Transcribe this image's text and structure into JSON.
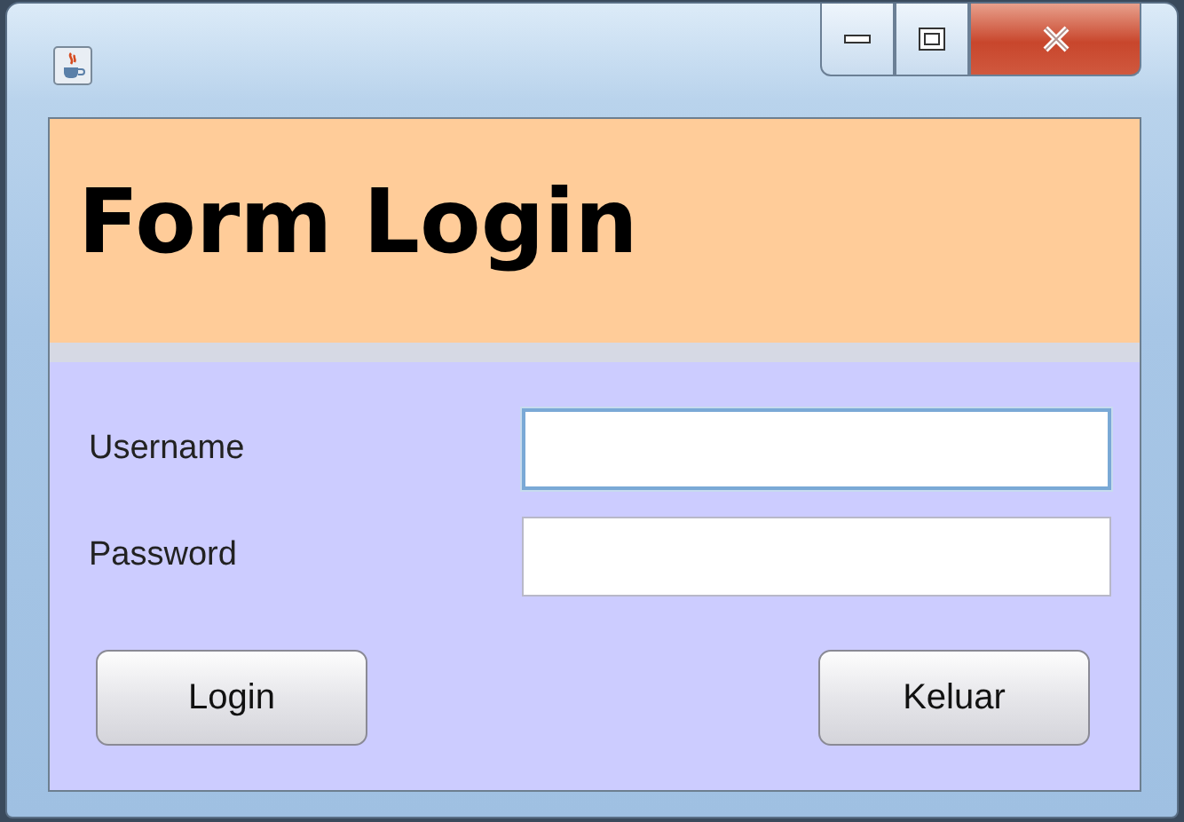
{
  "header": {
    "title": "Form Login"
  },
  "fields": [
    {
      "label": "Username",
      "focused": true
    },
    {
      "label": "Password",
      "focused": false
    }
  ],
  "buttons": [
    {
      "label": "Login"
    },
    {
      "label": "Keluar"
    }
  ]
}
